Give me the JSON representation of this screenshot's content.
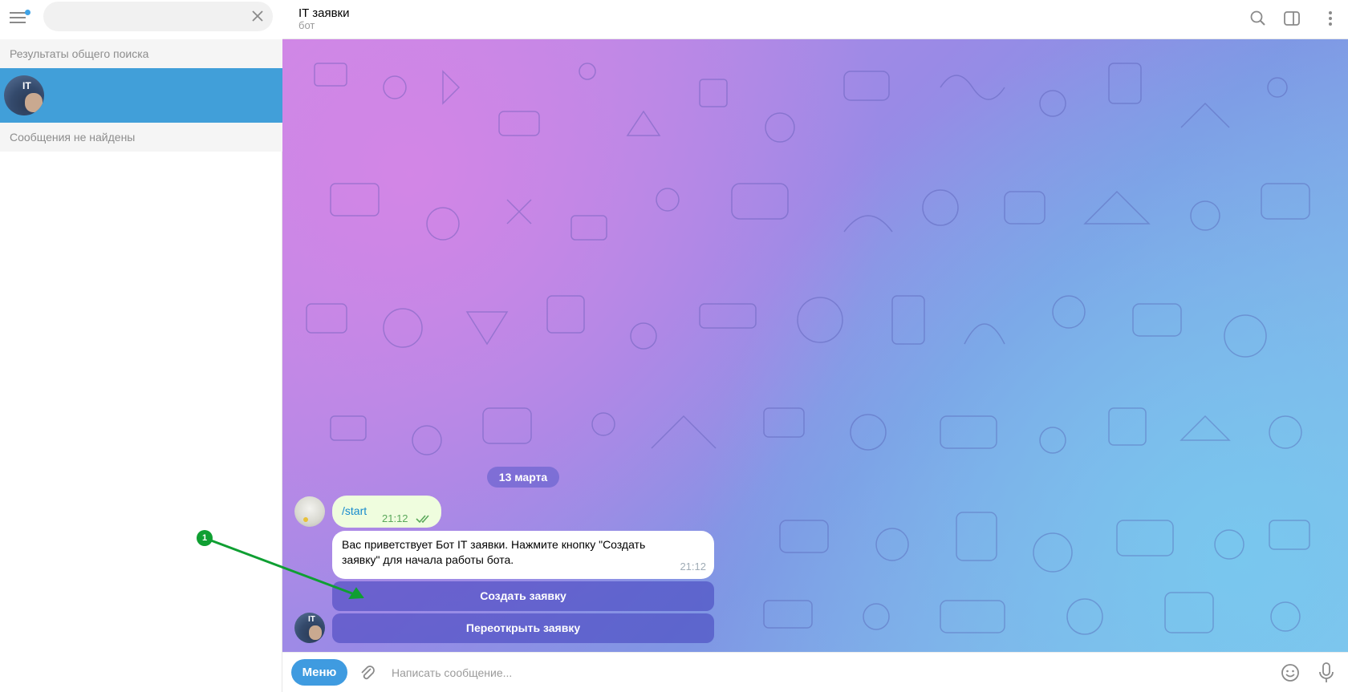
{
  "sidebar": {
    "search": {
      "value": "",
      "placeholder": ""
    },
    "global_results_header": "Результаты общего поиска",
    "selected_result": {
      "avatar_tag": "IT"
    },
    "messages_header": "Сообщения не найдены"
  },
  "chat": {
    "title": "IT заявки",
    "subtitle": "бот",
    "date_pill": "13 марта",
    "outgoing": {
      "text": "/start",
      "time": "21:12"
    },
    "incoming": {
      "text": "Вас приветствует Бот            IT заявки. Нажмите кнопку \"Создать заявку\" для начала работы бота.",
      "time": "21:12"
    },
    "bot_avatar_tag": "IT",
    "inline_buttons": [
      "Создать заявку",
      "Переоткрыть заявку"
    ]
  },
  "composer": {
    "menu_label": "Меню",
    "placeholder": "Написать сообщение..."
  },
  "annotation": {
    "marker": "1",
    "color": "#0f9f32"
  },
  "colors": {
    "accent": "#419fd9",
    "menu_button": "#3f9be0",
    "outgoing_bubble": "#effdde",
    "inline_button": "#4a4abf"
  },
  "icons": [
    "menu-icon",
    "close-icon",
    "search-icon",
    "side-panel-icon",
    "more-icon",
    "attach-icon",
    "emoji-icon",
    "mic-icon",
    "double-check-icon"
  ]
}
